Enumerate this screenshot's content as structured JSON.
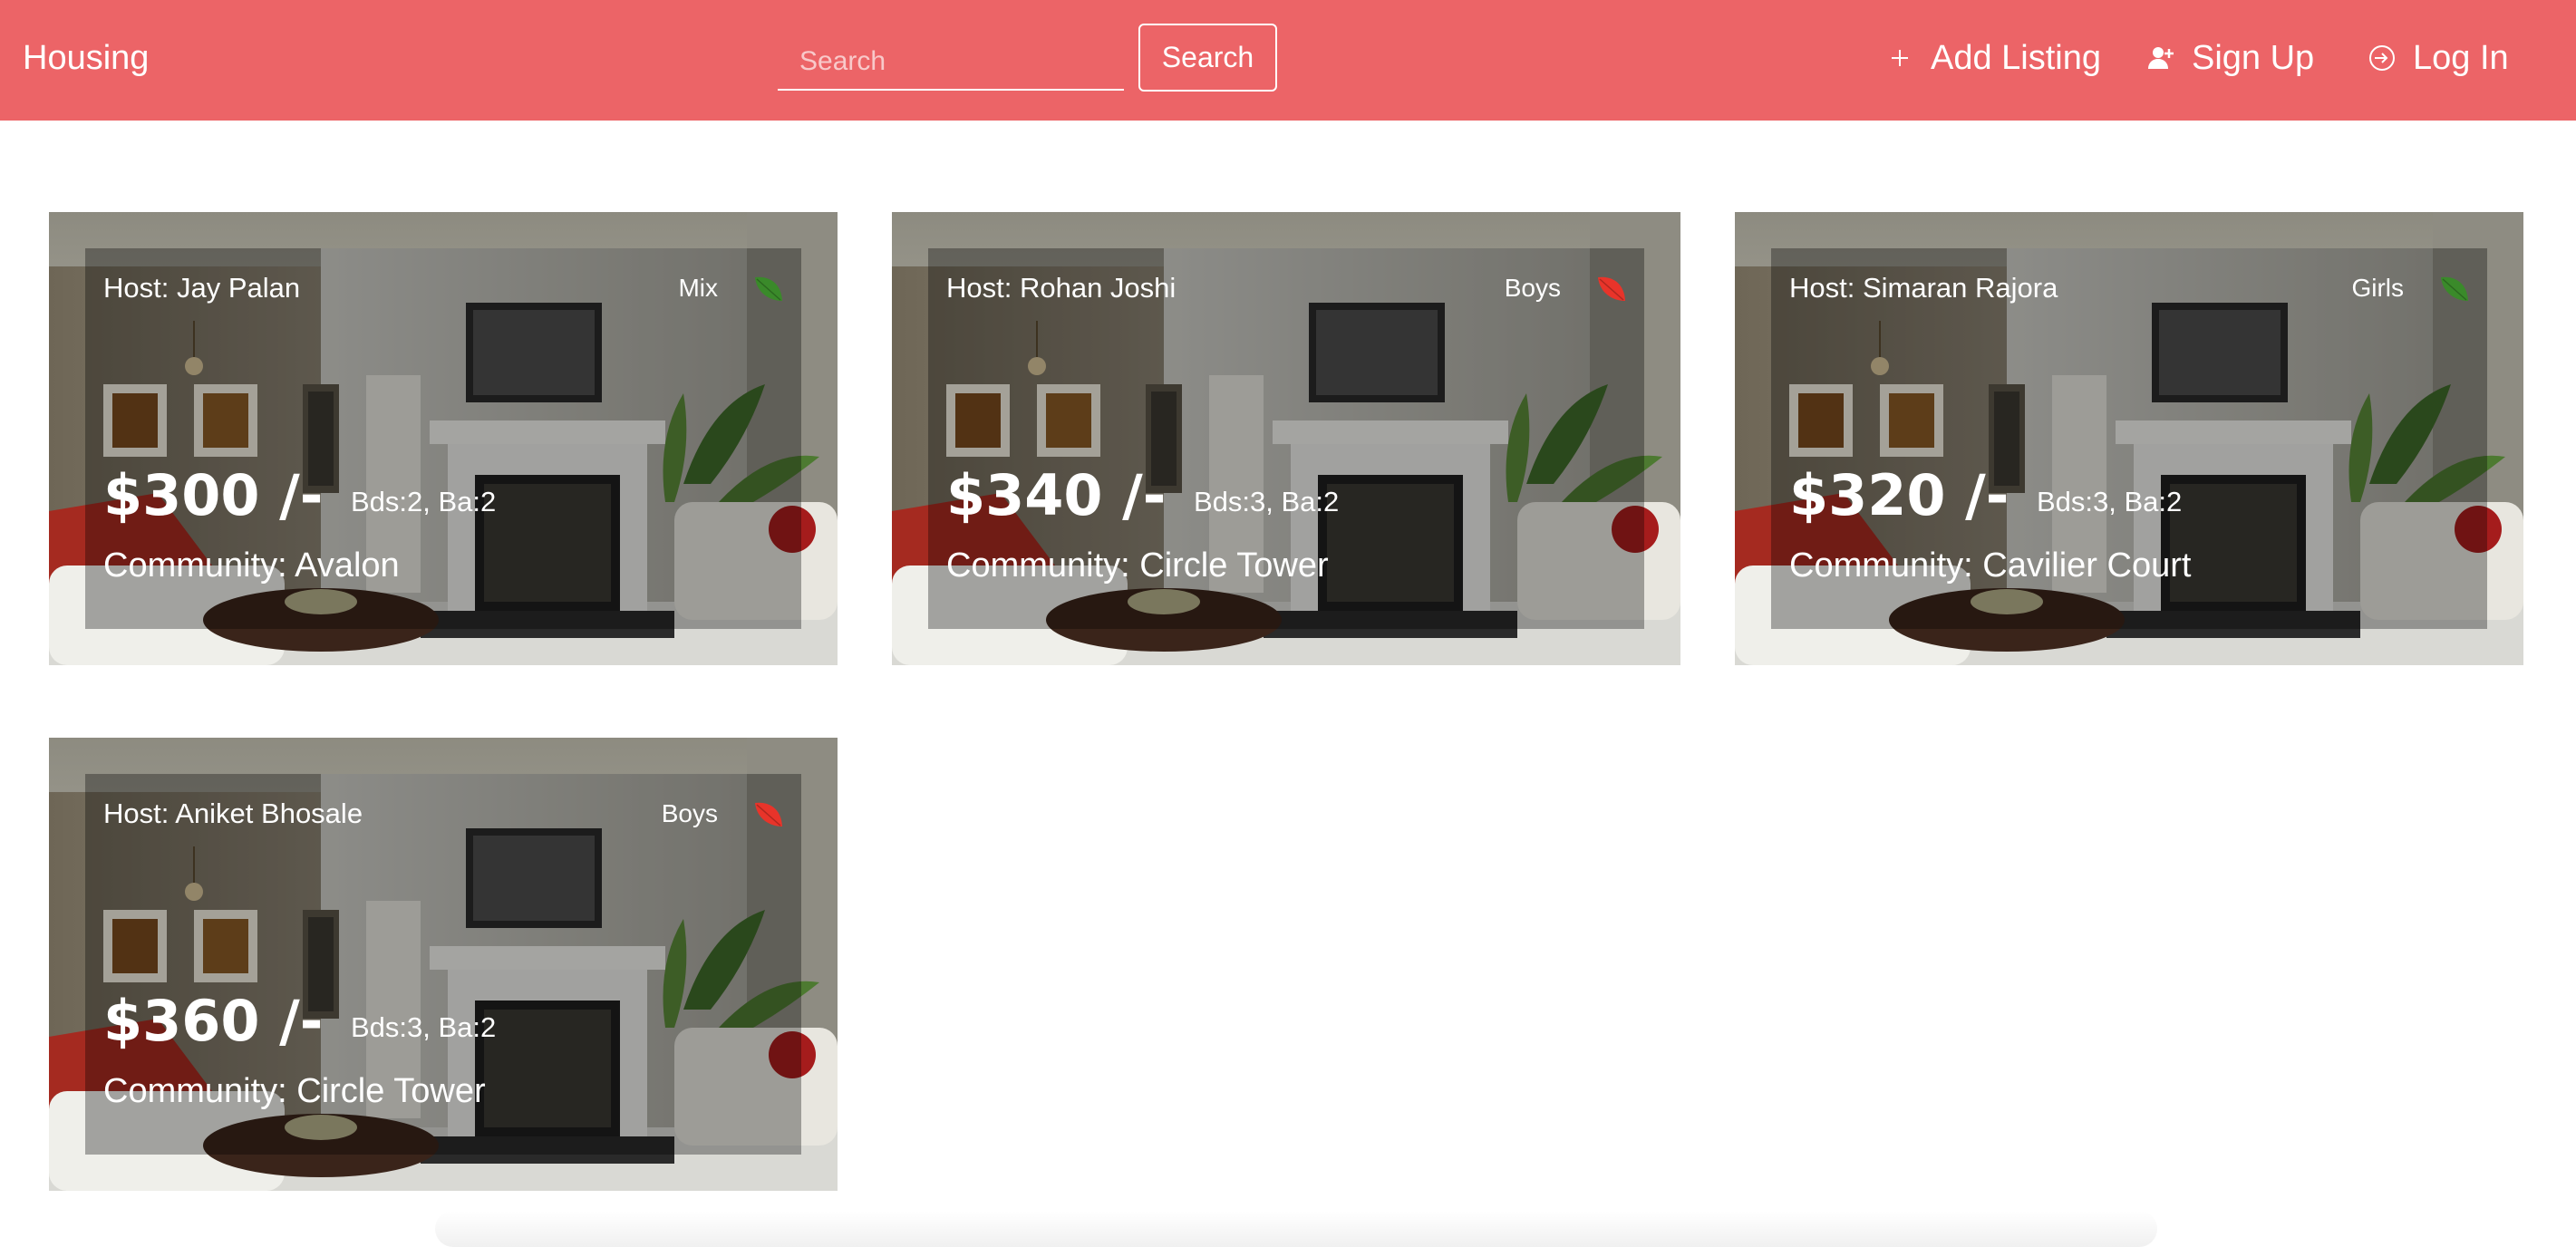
{
  "navbar": {
    "brand": "Housing",
    "search_placeholder": "Search",
    "search_button": "Search",
    "add_listing": "Add Listing",
    "sign_up": "Sign Up",
    "log_in": "Log In",
    "background_color": "#ec6467"
  },
  "listings": [
    {
      "host": "Host: Jay Palan",
      "gender": "Mix",
      "leaf_color": "#3a8a2a",
      "price": "$300 /-",
      "rooms": "Bds:2, Ba:2",
      "community": "Community: Avalon"
    },
    {
      "host": "Host: Rohan Joshi",
      "gender": "Boys",
      "leaf_color": "#e8342a",
      "price": "$340 /-",
      "rooms": "Bds:3, Ba:2",
      "community": "Community: Circle Tower"
    },
    {
      "host": "Host: Simaran Rajora",
      "gender": "Girls",
      "leaf_color": "#3a8a2a",
      "price": "$320 /-",
      "rooms": "Bds:3, Ba:2",
      "community": "Community: Cavilier Court"
    },
    {
      "host": "Host: Aniket Bhosale",
      "gender": "Boys",
      "leaf_color": "#e8342a",
      "price": "$360 /-",
      "rooms": "Bds:3, Ba:2",
      "community": "Community: Circle Tower"
    }
  ]
}
